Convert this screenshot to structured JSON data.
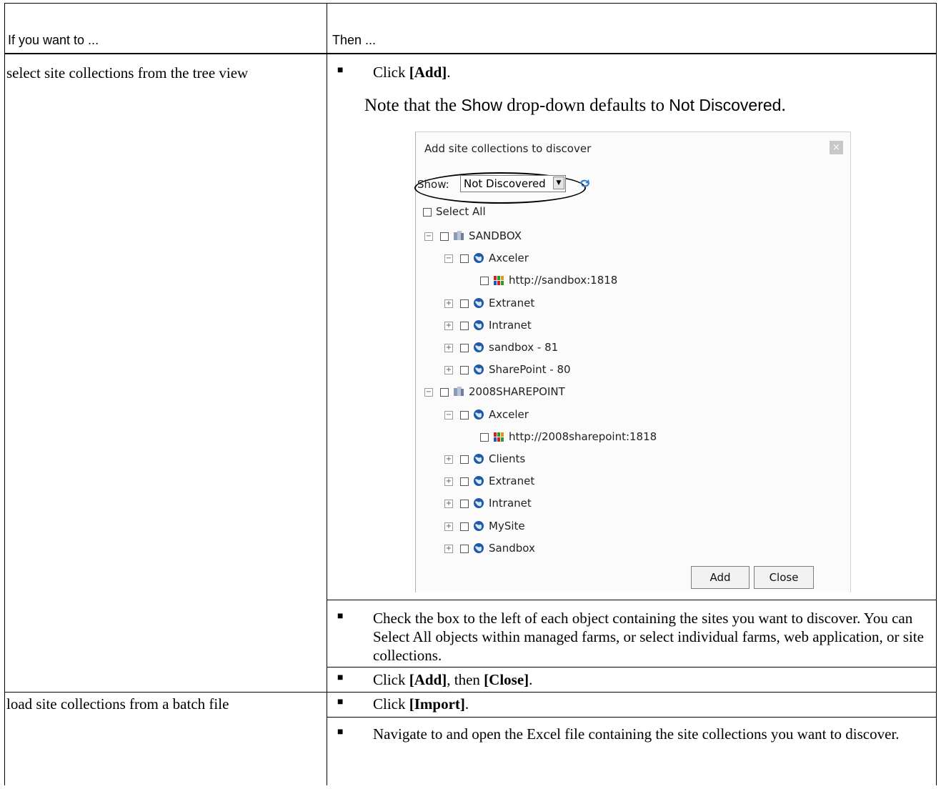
{
  "table": {
    "header_left": "If you want to ...",
    "header_right": "Then ..."
  },
  "row1": {
    "left": "select site collections from the tree view",
    "bullet1_prefix": "Click ",
    "bullet1_bold": "[Add]",
    "bullet1_suffix": ".",
    "note_prefix": "Note that the ",
    "note_show": "Show",
    "note_mid": " drop-down defaults to ",
    "note_value": "Not Discovered",
    "note_suffix": ".",
    "bullet2": "Check the box to the left of each object containing the sites you want to discover.  You can Select All objects within managed farms, or select individual farms, web application, or site collections.",
    "bullet3_prefix": "Click ",
    "bullet3_bold1": "[Add]",
    "bullet3_mid": ", then ",
    "bullet3_bold2": "[Close]",
    "bullet3_suffix": "."
  },
  "row2": {
    "left": "load site collections from a batch file",
    "bullet1_prefix": "Click ",
    "bullet1_bold": "[Import]",
    "bullet1_suffix": ".",
    "bullet2": "Navigate to and open the Excel file containing the site collections you want to discover."
  },
  "dialog": {
    "title": "Add site collections to discover",
    "close_glyph": "×",
    "show_label": "Show:",
    "show_value": "Not Discovered",
    "select_all": "Select All",
    "tree": [
      {
        "label": "SANDBOX",
        "icon": "server-icon",
        "expander": "−"
      },
      {
        "label": "Axceler",
        "icon": "globe-icon",
        "expander": "−"
      },
      {
        "label": "http://sandbox:1818",
        "icon": "site-collection-icon",
        "expander": ""
      },
      {
        "label": "Extranet",
        "icon": "globe-icon",
        "expander": "+"
      },
      {
        "label": "Intranet",
        "icon": "globe-icon",
        "expander": "+"
      },
      {
        "label": "sandbox - 81",
        "icon": "globe-icon",
        "expander": "+"
      },
      {
        "label": "SharePoint - 80",
        "icon": "globe-icon",
        "expander": "+"
      },
      {
        "label": "2008SHAREPOINT",
        "icon": "server-icon",
        "expander": "−"
      },
      {
        "label": "Axceler",
        "icon": "globe-icon",
        "expander": "−"
      },
      {
        "label": "http://2008sharepoint:1818",
        "icon": "site-collection-icon",
        "expander": ""
      },
      {
        "label": "Clients",
        "icon": "globe-icon",
        "expander": "+"
      },
      {
        "label": "Extranet",
        "icon": "globe-icon",
        "expander": "+"
      },
      {
        "label": "Intranet",
        "icon": "globe-icon",
        "expander": "+"
      },
      {
        "label": "MySite",
        "icon": "globe-icon",
        "expander": "+"
      },
      {
        "label": "Sandbox",
        "icon": "globe-icon",
        "expander": "+"
      }
    ],
    "add_label": "Add",
    "close_label": "Close"
  }
}
